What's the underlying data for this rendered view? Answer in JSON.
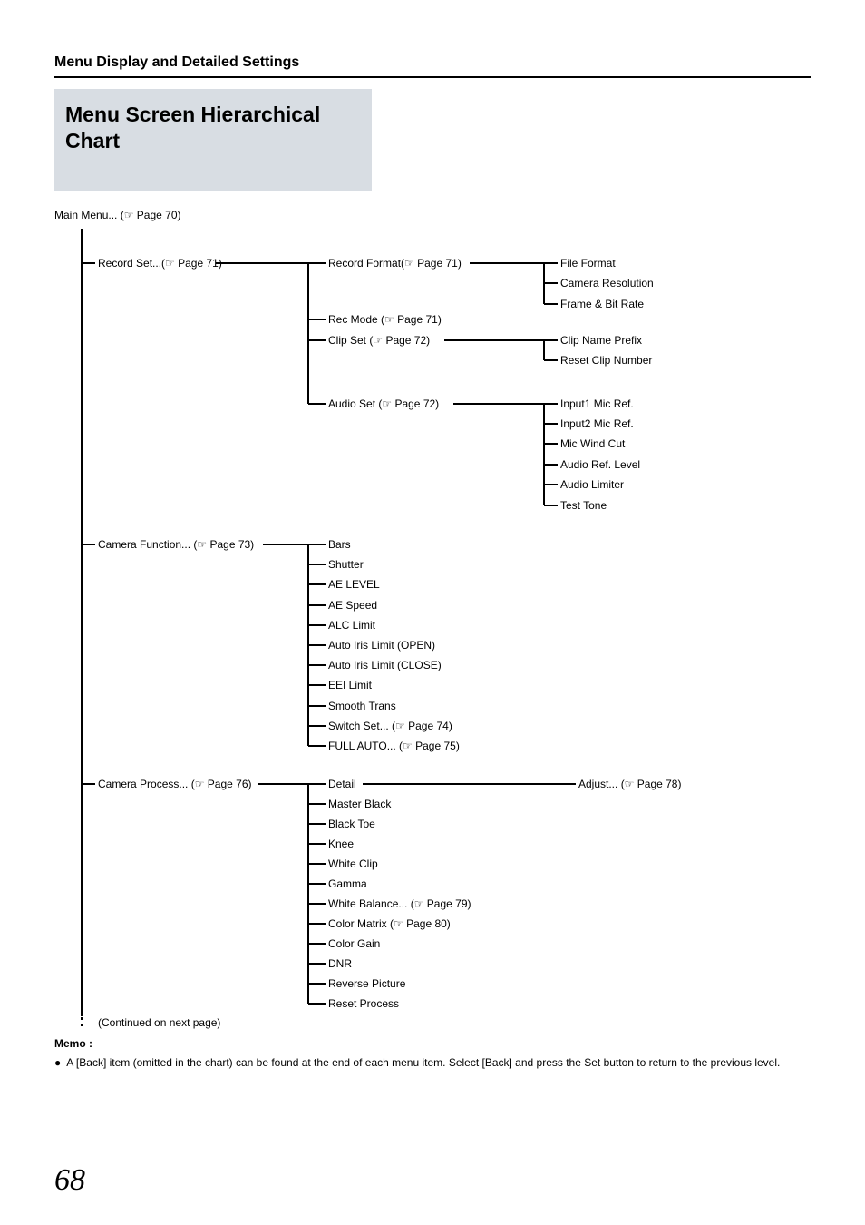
{
  "header": {
    "breadcrumb": "Menu Display and Detailed Settings"
  },
  "title": "Menu Screen Hierarchical Chart",
  "root": {
    "label": "Main Menu... (☞ Page 70)"
  },
  "col1": {
    "record_set": "Record Set...(☞ Page 71)",
    "camera_function": "Camera Function... (☞ Page 73)",
    "camera_process": "Camera Process... (☞ Page 76)",
    "continued": "(Continued on next page)"
  },
  "col2": {
    "record_format": "Record Format(☞ Page 71)",
    "rec_mode": "Rec Mode (☞ Page 71)",
    "clip_set": "Clip Set (☞ Page 72)",
    "audio_set": "Audio Set (☞ Page 72)",
    "bars": "Bars",
    "shutter": "Shutter",
    "ae_level": "AE LEVEL",
    "ae_speed": "AE Speed",
    "alc_limit": "ALC Limit",
    "auto_iris_open": "Auto Iris Limit (OPEN)",
    "auto_iris_close": "Auto Iris Limit (CLOSE)",
    "eei_limit": "EEI Limit",
    "smooth_trans": "Smooth Trans",
    "switch_set": "Switch Set... (☞ Page 74)",
    "full_auto": "FULL AUTO... (☞ Page 75)",
    "detail": "Detail",
    "master_black": "Master Black",
    "black_toe": "Black Toe",
    "knee": "Knee",
    "white_clip": "White Clip",
    "gamma": "Gamma",
    "white_balance": "White Balance... (☞ Page 79)",
    "color_matrix": "Color Matrix (☞ Page 80)",
    "color_gain": "Color Gain",
    "dnr": "DNR",
    "reverse_picture": "Reverse Picture",
    "reset_process": "Reset Process"
  },
  "col3": {
    "file_format": "File Format",
    "camera_resolution": "Camera Resolution",
    "frame_bit_rate": "Frame & Bit Rate",
    "clip_name_prefix": "Clip Name Prefix",
    "reset_clip_number": "Reset Clip Number",
    "input1_mic": "Input1 Mic Ref.",
    "input2_mic": "Input2 Mic Ref.",
    "mic_wind_cut": "Mic Wind Cut",
    "audio_ref_level": "Audio Ref. Level",
    "audio_limiter": "Audio Limiter",
    "test_tone": "Test Tone",
    "adjust": "Adjust... (☞ Page 78)"
  },
  "memo": {
    "label": "Memo :",
    "bullet": "●",
    "text": "A [Back] item (omitted in the chart) can be found at the end of each menu item. Select [Back] and press the Set button to return to the previous level."
  },
  "page_number": "68"
}
